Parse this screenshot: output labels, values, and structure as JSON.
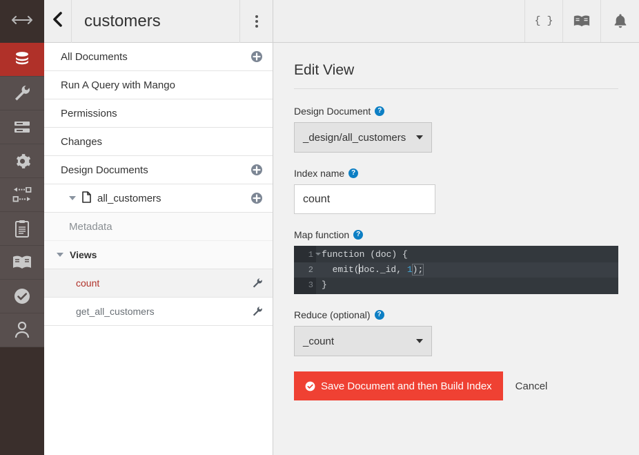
{
  "rail": {
    "items": [
      {
        "name": "database-icon",
        "label": "Databases",
        "active": true
      },
      {
        "name": "wrench-icon",
        "label": "Setup",
        "active": false
      },
      {
        "name": "server-list-icon",
        "label": "Active Tasks",
        "active": false
      },
      {
        "name": "gear-icon",
        "label": "Configuration",
        "active": false
      },
      {
        "name": "replication-icon",
        "label": "Replication",
        "active": false
      },
      {
        "name": "clipboard-icon",
        "label": "Documentation Notes",
        "active": false
      },
      {
        "name": "book-icon",
        "label": "Docs",
        "active": false
      },
      {
        "name": "check-circle-icon",
        "label": "Verify",
        "active": false
      },
      {
        "name": "user-icon",
        "label": "Account",
        "active": false
      }
    ],
    "expand_icon": "expand-arrows-icon"
  },
  "nav": {
    "back_icon": "back-chevron-icon",
    "database_name": "customers",
    "kebab_icon": "kebab-menu-icon",
    "items": [
      {
        "label": "All Documents",
        "type": "row",
        "add": true
      },
      {
        "label": "Run A Query with Mango",
        "type": "row",
        "add": false
      },
      {
        "label": "Permissions",
        "type": "row",
        "add": false
      },
      {
        "label": "Changes",
        "type": "row",
        "add": false
      },
      {
        "label": "Design Documents",
        "type": "row",
        "add": true
      }
    ],
    "design_doc": {
      "label": "all_customers",
      "add": true,
      "expanded": true
    },
    "metadata_label": "Metadata",
    "views_label": "Views",
    "views": [
      {
        "label": "count",
        "active": true
      },
      {
        "label": "get_all_customers",
        "active": false
      }
    ]
  },
  "header": {
    "buttons": [
      {
        "name": "json-icon",
        "glyph": "{ }",
        "label": "JSON"
      },
      {
        "name": "book-icon",
        "glyph": "",
        "label": "Documentation"
      },
      {
        "name": "bell-icon",
        "glyph": "",
        "label": "Notifications"
      }
    ]
  },
  "form": {
    "title": "Edit View",
    "design_document": {
      "label": "Design Document",
      "value": "_design/all_customers",
      "help": "?"
    },
    "index_name": {
      "label": "Index name",
      "value": "count",
      "placeholder": "Index name",
      "help": "?"
    },
    "map_function": {
      "label": "Map function",
      "help": "?",
      "lines": [
        {
          "num": "1",
          "fold": true,
          "active": false
        },
        {
          "num": "2",
          "fold": false,
          "active": true
        },
        {
          "num": "3",
          "fold": false,
          "active": false
        }
      ],
      "line1": "function (doc) {",
      "line2_a": "  emit(",
      "line2_b": "doc._id, ",
      "line2_num": "1",
      "line2_c": ");",
      "line3": "}"
    },
    "reduce": {
      "label": "Reduce (optional)",
      "value": "_count",
      "help": "?"
    },
    "save_label": "Save Document and then Build Index",
    "cancel_label": "Cancel"
  },
  "colors": {
    "accent_red": "#b03129",
    "button_red": "#ef4133",
    "help_blue": "#0d7fc4",
    "rail_dark": "#3a2f2c",
    "rail_gray": "#584f4e",
    "editor_bg": "#33383d"
  }
}
